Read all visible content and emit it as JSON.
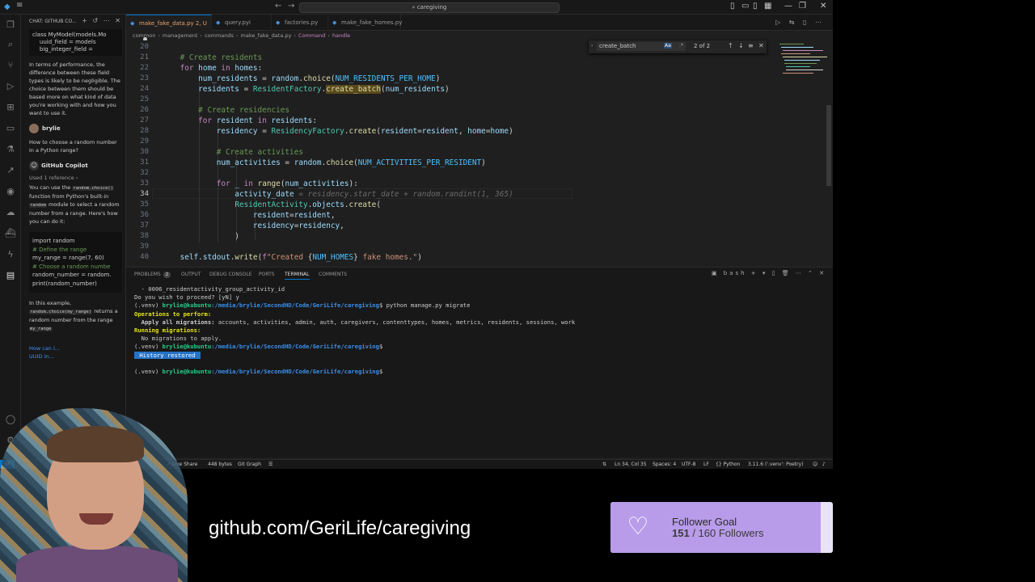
{
  "window": {
    "search_text": "caregiving"
  },
  "chat": {
    "header": "CHAT: GITHUB CO...",
    "top_code": [
      "class MyModel(models.Mo",
      "    uuid_field = models",
      "    big_integer_field ="
    ],
    "para1": "In terms of performance, the difference between these field types is likely to be negligible. The choice between them should be based more on what kind of data you're working with and how you want to use it.",
    "user_name": "brylie",
    "user_question": "How to choose a random number in a Python range?",
    "copilot_name": "GitHub Copilot",
    "used_ref": "Used 1 reference",
    "answer_p1": "You can use the",
    "answer_code1": "random.choice()",
    "answer_p2": "function from Python's built-in",
    "answer_code2": "random",
    "answer_p3": "module to select a random number from a range. Here's how you can do it:",
    "code_lines": [
      "import random",
      "",
      "# Define the range",
      "my_range = range(7, 60)",
      "",
      "# Choose a random numbe",
      "random_number = random.",
      "",
      "print(random_number)"
    ],
    "example_p1": "In this example,",
    "example_code1": "random.choice(my_range)",
    "example_p2": "returns a random number from the range",
    "example_code2": "my_range",
    "followup": "How can I...",
    "followup2": "UUID in..."
  },
  "tabs": [
    {
      "label": "make_fake_data.py 2, U",
      "active": true
    },
    {
      "label": "query.pyi",
      "active": false
    },
    {
      "label": "factories.py",
      "active": false
    },
    {
      "label": "make_fake_homes.py",
      "active": false
    }
  ],
  "breadcrumb": [
    "common",
    "management",
    "commands",
    "make_fake_data.py",
    "Command",
    "handle"
  ],
  "find": {
    "query": "create_batch",
    "match_case_label": "Aa",
    "regex_label": ".*",
    "count": "2 of 2"
  },
  "editor": {
    "line_numbers": [
      "20",
      "21",
      "22",
      "23",
      "24",
      "25",
      "26",
      "27",
      "28",
      "29",
      "30",
      "31",
      "32",
      "33",
      "34",
      "35",
      "36",
      "37",
      "38",
      "39",
      "40"
    ],
    "current_line": "34",
    "ghost_suggestion": "= residency.start_date + random.randint(1, 365)"
  },
  "panel": {
    "tabs": [
      {
        "label": "PROBLEMS",
        "badge": "2"
      },
      {
        "label": "OUTPUT"
      },
      {
        "label": "DEBUG CONSOLE"
      },
      {
        "label": "PORTS"
      },
      {
        "label": "TERMINAL",
        "active": true
      },
      {
        "label": "COMMENTS"
      }
    ],
    "shell_label": "bash"
  },
  "terminal": {
    "line1": "  - 0006_residentactivity_group_activity_id",
    "line2": "Do you wish to proceed? [yN] y",
    "prompt_env": "(.venv) ",
    "prompt_user": "brylie@kubuntu",
    "prompt_path": ":/media/brylie/SecondHD/Code/GeriLife/caregiving",
    "prompt_dollar": "$",
    "command": " python manage.py migrate",
    "ops_header": "Operations to perform:",
    "apply_label": "  Apply all migrations:",
    "apply_list": " accounts, activities, admin, auth, caregivers, contenttypes, homes, metrics, residents, sessions, work",
    "running": "Running migrations:",
    "no_migrations": "  No migrations to apply.",
    "history": " History restored "
  },
  "statusbar": {
    "live_share": "Live Share",
    "size": "448 bytes",
    "git_graph": "Git Graph",
    "position": "Ln 34, Col 35",
    "spaces": "Spaces: 4",
    "encoding": "UTF-8",
    "eol": "LF",
    "language": "Python",
    "interpreter": "3.11.6 ('.venv': Poetry)"
  },
  "overlay": {
    "repo_url": "github.com/GeriLife/caregiving",
    "goal_title": "Follower Goal",
    "goal_current": "151",
    "goal_total": " / 160 Followers",
    "goal_fraction": 0.944
  },
  "colors": {
    "accent": "#0078d4",
    "goal_fill": "#b89ce9",
    "goal_bg": "#e9e3f7"
  }
}
